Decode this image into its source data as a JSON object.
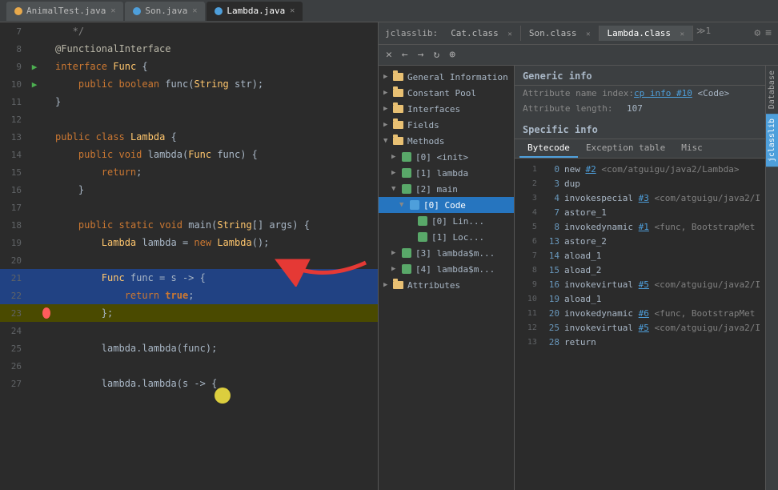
{
  "titlebar": {
    "tabs": [
      {
        "id": "animal-test",
        "label": "AnimalTest.java",
        "icon": "orange",
        "active": false
      },
      {
        "id": "son",
        "label": "Son.java",
        "icon": "blue",
        "active": false
      },
      {
        "id": "lambda",
        "label": "Lambda.java",
        "icon": "blue",
        "active": true
      }
    ]
  },
  "jcl_topbar": {
    "label": "jclasslib:",
    "tabs": [
      {
        "id": "cat-class",
        "label": "Cat.class",
        "active": false
      },
      {
        "id": "son-class",
        "label": "Son.class",
        "active": false
      },
      {
        "id": "lambda-class",
        "label": "Lambda.class",
        "active": true
      }
    ],
    "toolbar": {
      "close": "✕",
      "back": "←",
      "forward": "→",
      "refresh": "↻",
      "browser": "⊕"
    },
    "settings_icon": "⚙",
    "menu_icon": "≡"
  },
  "tree": {
    "items": [
      {
        "id": "general-info",
        "label": "General Information",
        "level": 0,
        "expanded": false,
        "selected": false
      },
      {
        "id": "constant-pool",
        "label": "Constant Pool",
        "level": 0,
        "expanded": false,
        "selected": false
      },
      {
        "id": "interfaces",
        "label": "Interfaces",
        "level": 0,
        "expanded": false,
        "selected": false
      },
      {
        "id": "fields",
        "label": "Fields",
        "level": 0,
        "expanded": false,
        "selected": false
      },
      {
        "id": "methods",
        "label": "Methods",
        "level": 0,
        "expanded": true,
        "selected": false
      },
      {
        "id": "init",
        "label": "[0] <init>",
        "level": 1,
        "expanded": false,
        "selected": false
      },
      {
        "id": "lambda-method",
        "label": "[1] lambda",
        "level": 1,
        "expanded": false,
        "selected": false
      },
      {
        "id": "main-method",
        "label": "[2] main",
        "level": 1,
        "expanded": true,
        "selected": false
      },
      {
        "id": "code",
        "label": "[0] Code",
        "level": 2,
        "expanded": true,
        "selected": true
      },
      {
        "id": "lin",
        "label": "[0] Lin...",
        "level": 3,
        "expanded": false,
        "selected": false
      },
      {
        "id": "loc",
        "label": "[1] Loc...",
        "level": 3,
        "expanded": false,
        "selected": false
      },
      {
        "id": "lambda-dollar-3",
        "label": "[3] lambda$m...",
        "level": 1,
        "expanded": false,
        "selected": false
      },
      {
        "id": "lambda-dollar-4",
        "label": "[4] lambda$m...",
        "level": 1,
        "expanded": false,
        "selected": false
      },
      {
        "id": "attributes",
        "label": "Attributes",
        "level": 0,
        "expanded": false,
        "selected": false
      }
    ]
  },
  "info_panel": {
    "generic_info_title": "Generic info",
    "attr_name_label": "Attribute name index:",
    "attr_name_value": "cp info #10",
    "attr_name_code": "<Code>",
    "attr_length_label": "Attribute length:",
    "attr_length_value": "107",
    "specific_info_title": "Specific info"
  },
  "bytecode_tabs": [
    {
      "id": "bytecode",
      "label": "Bytecode",
      "active": true
    },
    {
      "id": "exception-table",
      "label": "Exception table",
      "active": false
    },
    {
      "id": "misc",
      "label": "Misc",
      "active": false
    }
  ],
  "bytecode_lines": [
    {
      "num": 1,
      "offset": "0",
      "instruction": "new",
      "ref": "#2",
      "comment": "<com/atguigu/java2/Lambda>"
    },
    {
      "num": 2,
      "offset": "3",
      "instruction": "dup",
      "ref": "",
      "comment": ""
    },
    {
      "num": 3,
      "offset": "4",
      "instruction": "invokespecial",
      "ref": "#3",
      "comment": "<com/atguigu/java2/I"
    },
    {
      "num": 4,
      "offset": "7",
      "instruction": "astore_1",
      "ref": "",
      "comment": ""
    },
    {
      "num": 5,
      "offset": "8",
      "instruction": "invokedynamic",
      "ref": "#1",
      "comment": "<func, BootstrapMet"
    },
    {
      "num": 6,
      "offset": "13",
      "instruction": "astore_2",
      "ref": "",
      "comment": ""
    },
    {
      "num": 7,
      "offset": "14",
      "instruction": "aload_1",
      "ref": "",
      "comment": ""
    },
    {
      "num": 8,
      "offset": "15",
      "instruction": "aload_2",
      "ref": "",
      "comment": ""
    },
    {
      "num": 9,
      "offset": "16",
      "instruction": "invokevirtual",
      "ref": "#5",
      "comment": "<com/atguigu/java2/I"
    },
    {
      "num": 10,
      "offset": "19",
      "instruction": "aload_1",
      "ref": "",
      "comment": ""
    },
    {
      "num": 11,
      "offset": "20",
      "instruction": "invokedynamic",
      "ref": "#6",
      "comment": "<func, BootstrapMet"
    },
    {
      "num": 12,
      "offset": "25",
      "instruction": "invokevirtual",
      "ref": "#5",
      "comment": "<com/atguigu/java2/I"
    },
    {
      "num": 13,
      "offset": "28",
      "instruction": "return",
      "ref": "",
      "comment": ""
    }
  ],
  "code_lines": [
    {
      "num": 7,
      "content": "   */",
      "style": "comment",
      "arrow": false,
      "bp": false,
      "highlight": false
    },
    {
      "num": 8,
      "content": "@FunctionalInterface",
      "style": "annotation",
      "arrow": false,
      "bp": false,
      "highlight": false
    },
    {
      "num": 9,
      "content": "interface Func {",
      "style": "normal",
      "arrow": true,
      "bp": false,
      "highlight": false
    },
    {
      "num": 10,
      "content": "    public boolean func(String str);",
      "style": "normal",
      "arrow": true,
      "bp": false,
      "highlight": false
    },
    {
      "num": 11,
      "content": "}",
      "style": "normal",
      "arrow": false,
      "bp": false,
      "highlight": false
    },
    {
      "num": 12,
      "content": "",
      "style": "normal",
      "arrow": false,
      "bp": false,
      "highlight": false
    },
    {
      "num": 13,
      "content": "public class Lambda {",
      "style": "normal",
      "arrow": false,
      "bp": false,
      "highlight": false
    },
    {
      "num": 14,
      "content": "    public void lambda(Func func) {",
      "style": "normal",
      "arrow": false,
      "bp": false,
      "highlight": false
    },
    {
      "num": 15,
      "content": "        return;",
      "style": "normal",
      "arrow": false,
      "bp": false,
      "highlight": false
    },
    {
      "num": 16,
      "content": "    }",
      "style": "normal",
      "arrow": false,
      "bp": false,
      "highlight": false
    },
    {
      "num": 17,
      "content": "",
      "style": "normal",
      "arrow": false,
      "bp": false,
      "highlight": false
    },
    {
      "num": 18,
      "content": "    public static void main(String[] args) {",
      "style": "normal",
      "arrow": false,
      "bp": false,
      "highlight": false
    },
    {
      "num": 19,
      "content": "        Lambda lambda = new Lambda();",
      "style": "normal",
      "arrow": false,
      "bp": false,
      "highlight": false
    },
    {
      "num": 20,
      "content": "",
      "style": "normal",
      "arrow": false,
      "bp": false,
      "highlight": false
    },
    {
      "num": 21,
      "content": "        Func func = s -> {",
      "style": "normal",
      "arrow": false,
      "bp": false,
      "highlight": true
    },
    {
      "num": 22,
      "content": "            return true;",
      "style": "normal",
      "arrow": false,
      "bp": false,
      "highlight": true
    },
    {
      "num": 23,
      "content": "        };",
      "style": "normal",
      "arrow": false,
      "bp": true,
      "highlight": false,
      "yellow": true
    },
    {
      "num": 24,
      "content": "",
      "style": "normal",
      "arrow": false,
      "bp": false,
      "highlight": false
    },
    {
      "num": 25,
      "content": "        lambda.lambda(func);",
      "style": "normal",
      "arrow": false,
      "bp": false,
      "highlight": false
    },
    {
      "num": 26,
      "content": "",
      "style": "normal",
      "arrow": false,
      "bp": false,
      "highlight": false
    },
    {
      "num": 27,
      "content": "        lambda.lambda(s -> {",
      "style": "normal",
      "arrow": false,
      "bp": false,
      "highlight": false
    }
  ],
  "sidebar_labels": [
    {
      "id": "database",
      "label": "Database",
      "active": false
    },
    {
      "id": "jclasslib",
      "label": "jclasslib",
      "active": true
    }
  ]
}
